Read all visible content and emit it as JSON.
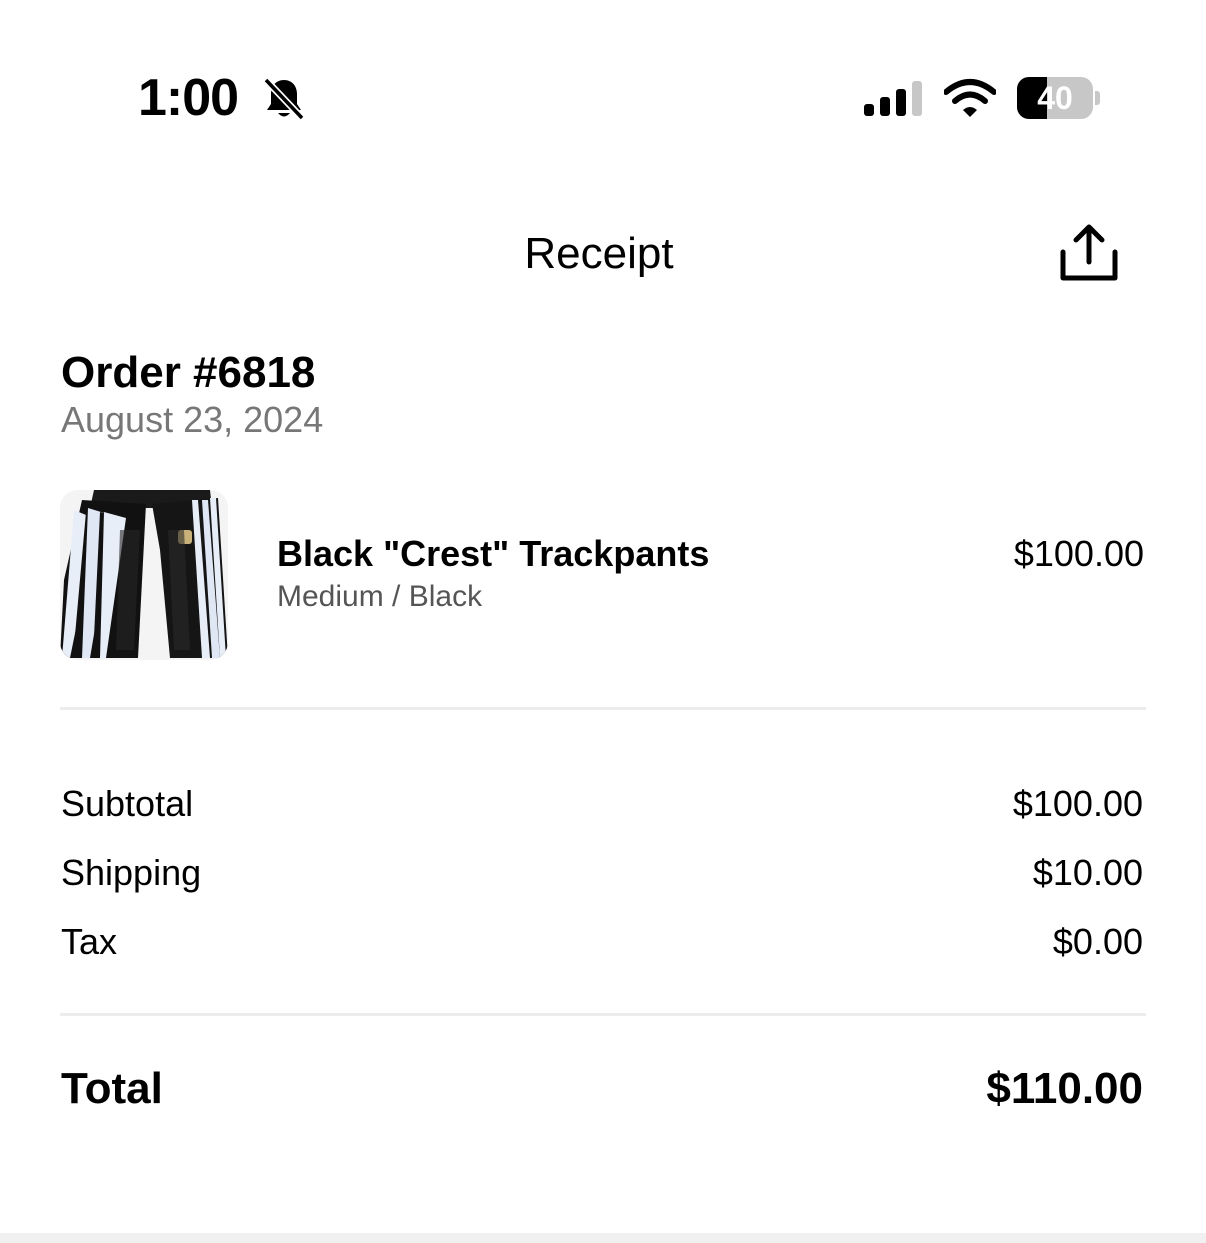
{
  "status_bar": {
    "time": "1:00",
    "battery_level": "40",
    "battery_fraction": 0.4,
    "icons": [
      "bell-slash-icon",
      "cellular-signal-icon",
      "wifi-icon",
      "battery-icon"
    ]
  },
  "header": {
    "title": "Receipt",
    "share_icon": "share-icon"
  },
  "order": {
    "number": "Order #6818",
    "date": "August 23, 2024"
  },
  "items": [
    {
      "name": "Black \"Crest\" Trackpants",
      "variant": "Medium / Black",
      "price": "$100.00"
    }
  ],
  "summary": {
    "subtotal_label": "Subtotal",
    "subtotal_value": "$100.00",
    "shipping_label": "Shipping",
    "shipping_value": "$10.00",
    "tax_label": "Tax",
    "tax_value": "$0.00",
    "total_label": "Total",
    "total_value": "$110.00"
  },
  "colors": {
    "text_primary": "#000000",
    "text_secondary": "#777777",
    "divider": "#ececec",
    "battery_track": "#c7c7c7"
  }
}
